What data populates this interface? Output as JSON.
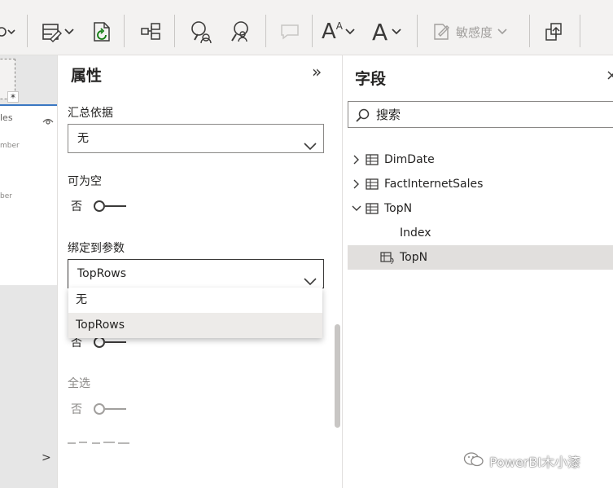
{
  "ribbon": {
    "sensitivity_label": "敏感度",
    "font_size_glyph": "A",
    "font_size_superscript": "A",
    "icons": [
      "chevron-down-icon",
      "format-painter-icon",
      "refresh-icon",
      "field-list-icon",
      "search-people-icon",
      "search-person-icon",
      "comment-icon",
      "grow-font-icon",
      "font-icon",
      "sensitivity-icon",
      "publish-icon"
    ]
  },
  "canvas": {
    "star": "*",
    "visual_title": "les",
    "placeholders": [
      "mber",
      "ber"
    ],
    "chevron": ">"
  },
  "properties": {
    "title": "属性",
    "collapse_glyph": "»",
    "summarize_by_label": "汇总依据",
    "summarize_by_value": "无",
    "nullable_label": "可为空",
    "nullable_value": "否",
    "bind_label": "绑定到参数",
    "bind_value": "TopRows",
    "bind_options": [
      "无",
      "TopRows"
    ],
    "bind_selected": "TopRows",
    "hidden_toggle_value": "否",
    "select_all_label": "全选",
    "select_all_value": "否"
  },
  "fields": {
    "title": "字段",
    "close_glyph": "×",
    "search_placeholder": "搜索",
    "tables": [
      {
        "name": "DimDate",
        "expanded": false
      },
      {
        "name": "FactInternetSales",
        "expanded": false
      },
      {
        "name": "TopN",
        "expanded": true
      }
    ],
    "topn_fields": [
      "Index",
      "TopN"
    ],
    "selected_field": "TopN"
  },
  "watermark": {
    "text": "PowerBI木小漆"
  },
  "colors": {
    "ribbon_bg": "#f3f2f1",
    "selection_bg": "#e1dfdd",
    "accent": "#3a77c2",
    "text": "#252423",
    "disabled": "#8a8886"
  }
}
